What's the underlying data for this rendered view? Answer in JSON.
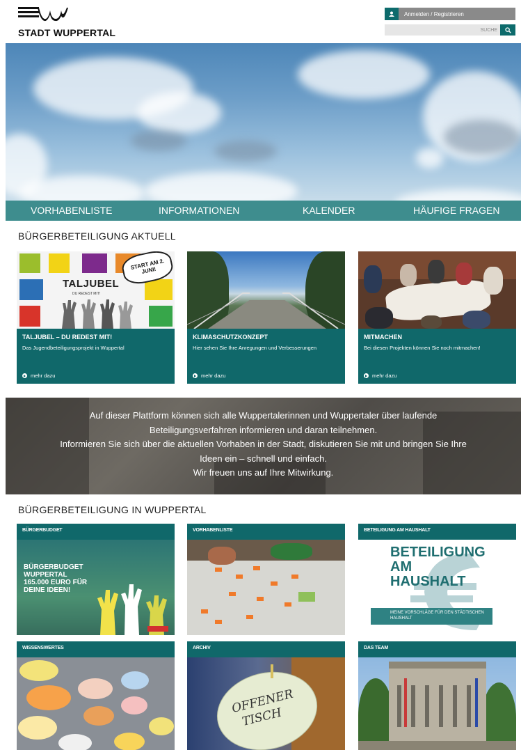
{
  "header": {
    "city_name": "STADT WUPPERTAL",
    "login_label": "Anmelden / Registrieren",
    "search_placeholder": "SUCHE"
  },
  "nav": {
    "items": [
      {
        "label": "VORHABENLISTE"
      },
      {
        "label": "INFORMATIONEN"
      },
      {
        "label": "KALENDER"
      },
      {
        "label": "HÄUFIGE FRAGEN"
      }
    ]
  },
  "aktuell": {
    "title": "BÜRGERBETEILIGUNG AKTUELL",
    "cards": [
      {
        "title": "TALJUBEL – DU REDEST MIT!",
        "description": "Das Jugendbeteiligungsprojekt in Wuppertal",
        "more": "mehr dazu",
        "poster_title": "TALJUBEL",
        "poster_sub": "DU REDEST MIT!",
        "bubble": "START AM 2. JUNI!"
      },
      {
        "title": "KLIMASCHUTZKONZEPT",
        "description": "Hier sehen Sie Ihre Anregungen und Verbesserungen",
        "more": "mehr dazu"
      },
      {
        "title": "MITMACHEN",
        "description": "Bei diesen Projekten können Sie noch mitmachen!",
        "more": "mehr dazu"
      }
    ]
  },
  "info": {
    "lines": [
      "Auf dieser Plattform können sich alle Wuppertalerinnen und Wuppertaler über laufende",
      "Beteiligungsverfahren informieren und daran teilnehmen.",
      "Informieren Sie sich über die aktuellen Vorhaben in der Stadt, diskutieren Sie mit und bringen Sie Ihre",
      "Ideen ein – schnell und einfach.",
      "Wir freuen uns auf Ihre Mitwirkung."
    ]
  },
  "wuppertal": {
    "title": "BÜRGERBETEILIGUNG IN WUPPERTAL",
    "tiles": [
      {
        "label": "BÜRGERBUDGET",
        "image_text": [
          "BÜRGERBUDGET",
          "WUPPERTAL",
          "165.000 EURO FÜR",
          "DEINE IDEEN!"
        ]
      },
      {
        "label": "VORHABENLISTE"
      },
      {
        "label": "BETEILIGUNG AM HAUSHALT",
        "image_text": [
          "BETEILIGUNG",
          "AM",
          "HAUSHALT"
        ],
        "image_sub": "MEINE VORSCHLÄGE FÜR DEN STÄDTISCHEN HAUSHALT"
      },
      {
        "label": "WISSENSWERTES"
      },
      {
        "label": "ARCHIV",
        "image_text": [
          "OFFENER",
          "TISCH"
        ]
      },
      {
        "label": "DAS TEAM"
      }
    ]
  },
  "colors": {
    "teal_dark": "#10686a",
    "teal_nav": "#3e8d8e",
    "login_grey": "#8a8a8a"
  }
}
